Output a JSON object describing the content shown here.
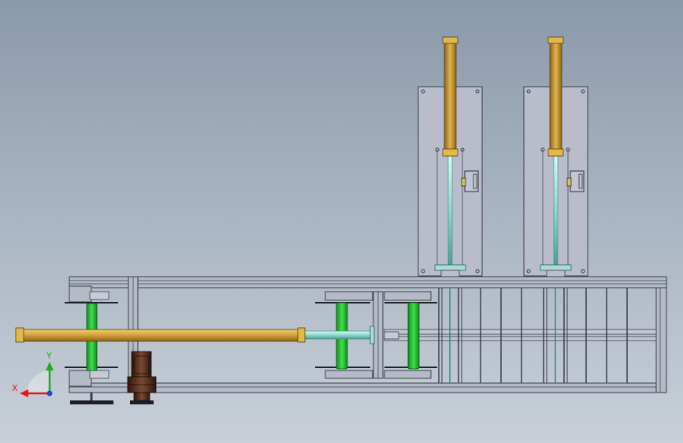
{
  "view": {
    "type": "cad-assembly-front-view",
    "background_top": "#8a99ab",
    "background_bottom": "#c8cfd8"
  },
  "colors": {
    "frame": "#b4bac6",
    "frame_edge": "#3a3f4a",
    "plate": "#b9bccb",
    "cylinder_body": "#c9993a",
    "cylinder_cap": "#e2b84b",
    "piston_rod": "#9fe4da",
    "roller": "#2fc93b",
    "motor": "#5a3424",
    "axis_x": "#e01a1a",
    "axis_y": "#18b018",
    "axis_z": "#2244dd"
  },
  "triad": {
    "x_label": "X",
    "y_label": "Y"
  }
}
